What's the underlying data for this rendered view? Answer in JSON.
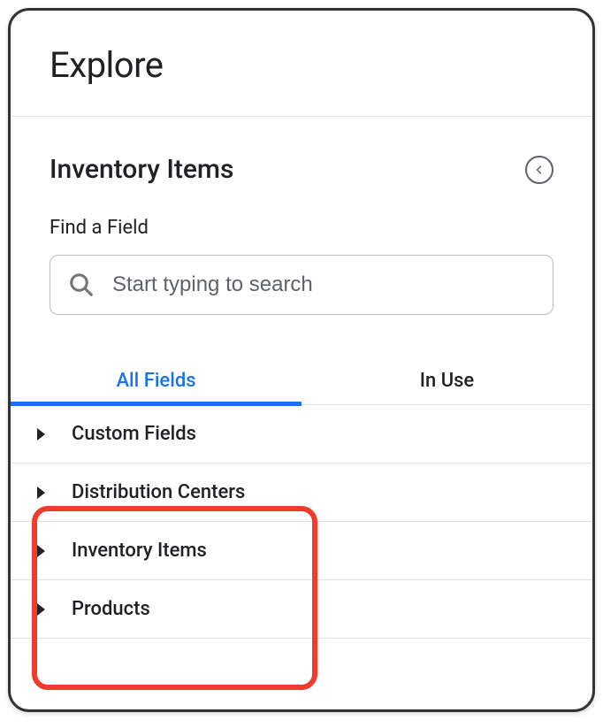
{
  "header": {
    "title": "Explore"
  },
  "section": {
    "title": "Inventory Items",
    "searchLabel": "Find a Field",
    "searchPlaceholder": "Start typing to search"
  },
  "tabs": {
    "allFields": "All Fields",
    "inUse": "In Use"
  },
  "fields": {
    "item0": "Custom Fields",
    "item1": "Distribution Centers",
    "item2": "Inventory Items",
    "item3": "Products"
  }
}
